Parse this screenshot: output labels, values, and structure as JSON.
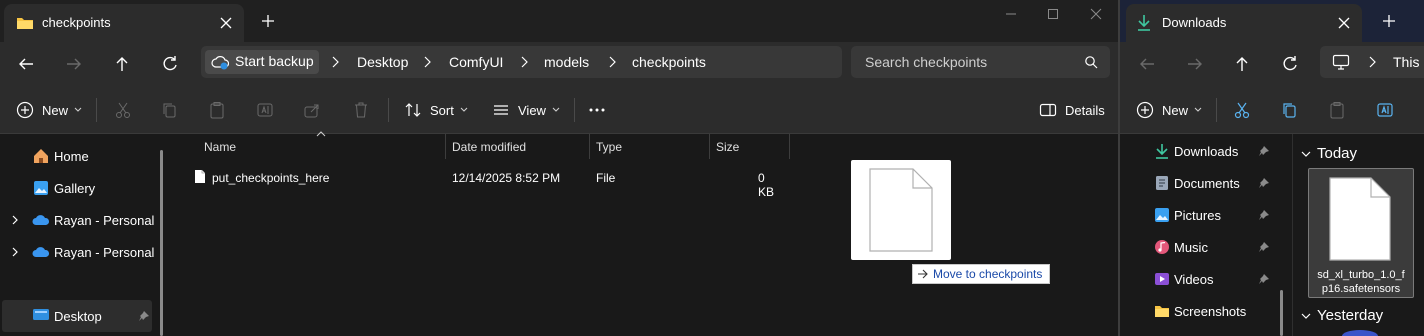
{
  "left_window": {
    "tab_title": "checkpoints",
    "tab_icon": "folder-icon",
    "address": {
      "backup_label": "Start backup",
      "crumbs": [
        "Desktop",
        "ComfyUI",
        "models",
        "checkpoints"
      ]
    },
    "search_placeholder": "Search checkpoints",
    "commands": {
      "new": "New",
      "sort": "Sort",
      "view": "View",
      "details": "Details"
    },
    "nav": {
      "items": [
        "Home",
        "Gallery",
        "Rayan - Personal",
        "Rayan - Personal",
        "Desktop"
      ]
    },
    "columns": [
      "Name",
      "Date modified",
      "Type",
      "Size"
    ],
    "files": [
      {
        "name": "put_checkpoints_here",
        "date": "12/14/2025 8:52 PM",
        "type": "File",
        "size": "0 KB"
      }
    ],
    "drag_tooltip": "Move to checkpoints"
  },
  "right_window": {
    "tab_title": "Downloads",
    "address_crumb": "This P",
    "commands": {
      "new": "New"
    },
    "quick_access": [
      "Downloads",
      "Documents",
      "Pictures",
      "Music",
      "Videos",
      "Screenshots"
    ],
    "groups": [
      "Today",
      "Yesterday"
    ],
    "file_tile_name": "sd_xl_turbo_1.0_fp16.safetensors",
    "file_tile_lines": [
      "sd_xl_turbo_1.0_f",
      "p16.safetensors"
    ]
  },
  "colors": {
    "background": "#191919",
    "bar": "#2c2c2c",
    "accent_tooltip_text": "#1a49a8",
    "downloads_tab_bg": "#1c2338",
    "selected_nav": "#2d2d2d"
  }
}
